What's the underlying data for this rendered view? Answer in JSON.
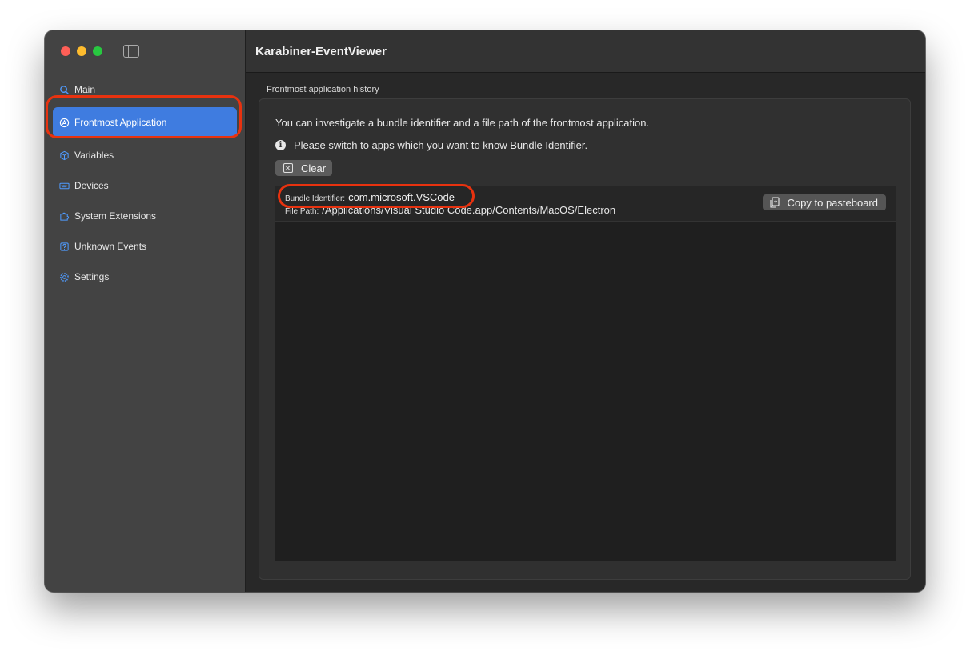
{
  "window": {
    "title": "Karabiner-EventViewer"
  },
  "sidebar": {
    "items": [
      {
        "label": "Main",
        "icon": "search-icon"
      },
      {
        "label": "Frontmost Application",
        "icon": "app-icon",
        "active": true
      },
      {
        "label": "Variables",
        "icon": "cube-icon"
      },
      {
        "label": "Devices",
        "icon": "keyboard-icon"
      },
      {
        "label": "System Extensions",
        "icon": "puzzle-icon"
      },
      {
        "label": "Unknown Events",
        "icon": "question-icon"
      },
      {
        "label": "Settings",
        "icon": "gear-icon"
      }
    ]
  },
  "main": {
    "group_label": "Frontmost application history",
    "description": "You can investigate a bundle identifier and a file path of the frontmost application.",
    "info": "Please switch to apps which you want to know Bundle Identifier.",
    "clear_label": "Clear",
    "entries": [
      {
        "bundle_label": "Bundle Identifier:",
        "bundle_value": "com.microsoft.VSCode",
        "path_label": "File Path:",
        "path_value": "/Applications/Visual Studio Code.app/Contents/MacOS/Electron",
        "copy_label": "Copy to pasteboard"
      }
    ]
  },
  "colors": {
    "accent": "#3f7ce0",
    "highlight": "#e8320f",
    "sidebar_bg": "#434343",
    "content_bg": "#282828"
  }
}
